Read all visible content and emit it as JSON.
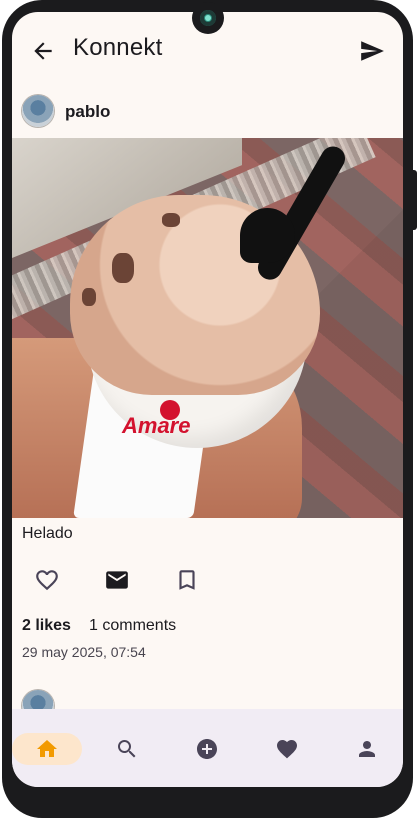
{
  "app": {
    "title": "Konnekt"
  },
  "post": {
    "username": "pablo",
    "caption": "Helado",
    "likes": "2 likes",
    "comments": "1 comments",
    "date": "29 may 2025, 07:54",
    "photo_logo_text": "Amare"
  },
  "icons": {
    "back": "arrow-back-icon",
    "send": "send-icon",
    "like": "heart-outline-icon",
    "message": "mail-icon",
    "bookmark": "bookmark-outline-icon"
  },
  "bottom_nav": {
    "items": [
      {
        "name": "home",
        "icon": "home-icon",
        "active": true
      },
      {
        "name": "search",
        "icon": "search-icon",
        "active": false
      },
      {
        "name": "add",
        "icon": "add-circle-icon",
        "active": false
      },
      {
        "name": "favorites",
        "icon": "heart-icon",
        "active": false
      },
      {
        "name": "profile",
        "icon": "person-icon",
        "active": false
      }
    ]
  },
  "colors": {
    "background": "#fdf8f4",
    "nav_background": "#f1ecf4",
    "nav_active_pill": "#fde6cc",
    "active_icon": "#f29a00",
    "icon": "#4a4458",
    "text": "#1c1b1f"
  }
}
